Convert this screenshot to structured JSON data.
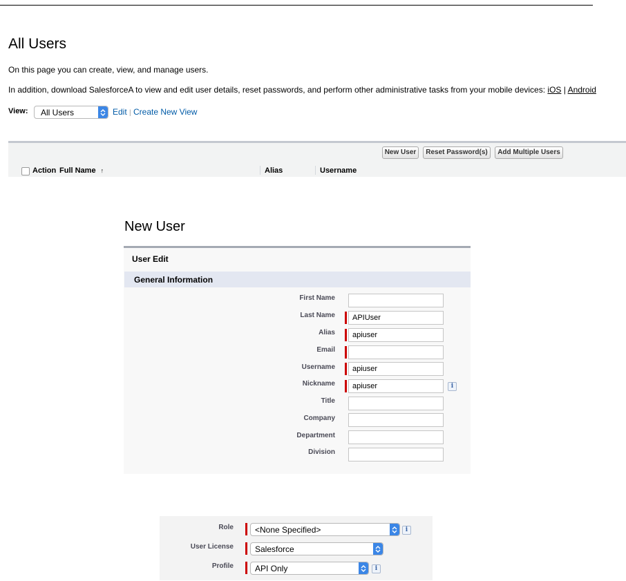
{
  "page": {
    "title": "All Users",
    "intro": "On this page you can create, view, and manage users.",
    "mobile_text": "In addition, download SalesforceA to view and edit user details, reset passwords, and perform other administrative tasks from your mobile devices:",
    "ios_link": "iOS",
    "separator": "|",
    "android_link": "Android"
  },
  "view": {
    "label": "View:",
    "selected": "All Users",
    "edit_link": "Edit",
    "link_separator": "|",
    "create_link": "Create New View"
  },
  "list": {
    "buttons": [
      "New User",
      "Reset Password(s)",
      "Add Multiple Users"
    ],
    "columns": {
      "action": "Action",
      "full_name": "Full Name",
      "sort_indicator": "↑",
      "alias": "Alias",
      "username": "Username"
    }
  },
  "new_user": {
    "title": "New User",
    "panel_title": "User Edit",
    "section_title": "General Information",
    "fields": [
      {
        "label": "First Name",
        "value": "",
        "required": false
      },
      {
        "label": "Last Name",
        "value": "APIUser",
        "required": true
      },
      {
        "label": "Alias",
        "value": "apiuser",
        "required": true
      },
      {
        "label": "Email",
        "value": "",
        "required": true
      },
      {
        "label": "Username",
        "value": "apiuser",
        "required": true
      },
      {
        "label": "Nickname",
        "value": "apiuser",
        "required": true
      },
      {
        "label": "Title",
        "value": "",
        "required": false
      },
      {
        "label": "Company",
        "value": "",
        "required": false
      },
      {
        "label": "Department",
        "value": "",
        "required": false
      },
      {
        "label": "Division",
        "value": "",
        "required": false
      }
    ],
    "info_glyph": "i"
  },
  "role_section": {
    "role": {
      "label": "Role",
      "value": "<None Specified>"
    },
    "license": {
      "label": "User License",
      "value": "Salesforce"
    },
    "profile": {
      "label": "Profile",
      "value": "API Only"
    }
  },
  "colors": {
    "link": "#015ba7",
    "required": "#cc0000",
    "select_accent": "#3b86e6",
    "section_bar": "#e3e7f1"
  }
}
